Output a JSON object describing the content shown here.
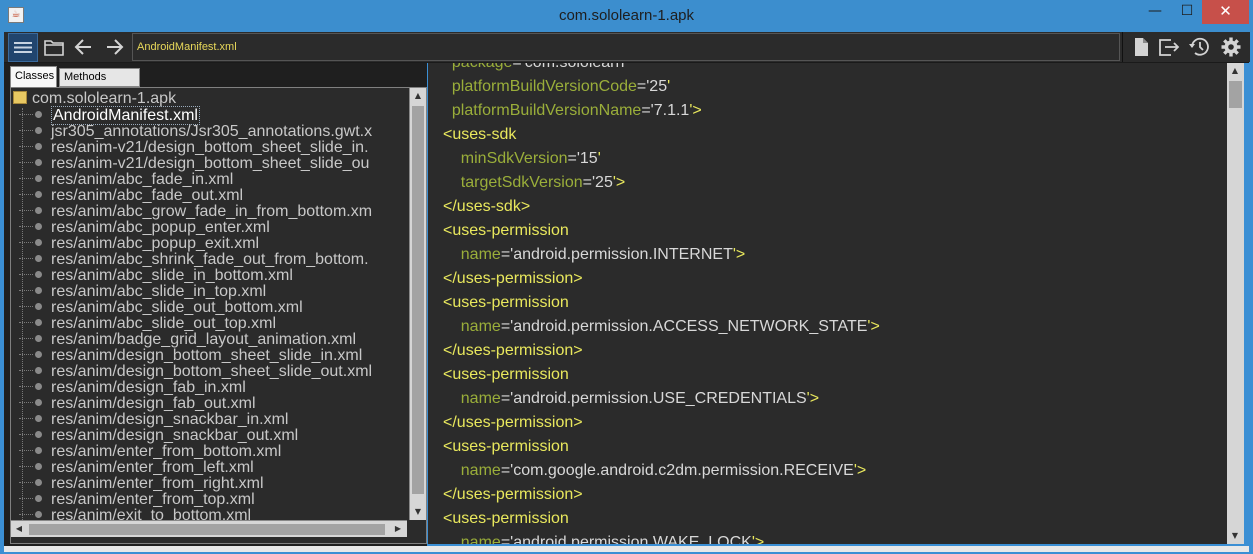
{
  "window": {
    "title": "com.sololearn-1.apk",
    "minimize": "—",
    "maximize": "☐",
    "close": "✕"
  },
  "toolbar": {
    "path": "AndroidManifest.xml",
    "icons": [
      "menu-icon",
      "folder-open-icon",
      "back-arrow-icon",
      "forward-arrow-icon",
      "file-icon",
      "export-icon",
      "history-icon",
      "gear-icon"
    ]
  },
  "tabs": {
    "classes": "Classes",
    "methods_count": "Methods count"
  },
  "tree": {
    "root": "com.sololearn-1.apk",
    "items": [
      "AndroidManifest.xml",
      "jsr305_annotations/Jsr305_annotations.gwt.x",
      "res/anim-v21/design_bottom_sheet_slide_in.",
      "res/anim-v21/design_bottom_sheet_slide_ou",
      "res/anim/abc_fade_in.xml",
      "res/anim/abc_fade_out.xml",
      "res/anim/abc_grow_fade_in_from_bottom.xm",
      "res/anim/abc_popup_enter.xml",
      "res/anim/abc_popup_exit.xml",
      "res/anim/abc_shrink_fade_out_from_bottom.",
      "res/anim/abc_slide_in_bottom.xml",
      "res/anim/abc_slide_in_top.xml",
      "res/anim/abc_slide_out_bottom.xml",
      "res/anim/abc_slide_out_top.xml",
      "res/anim/badge_grid_layout_animation.xml",
      "res/anim/design_bottom_sheet_slide_in.xml",
      "res/anim/design_bottom_sheet_slide_out.xml",
      "res/anim/design_fab_in.xml",
      "res/anim/design_fab_out.xml",
      "res/anim/design_snackbar_in.xml",
      "res/anim/design_snackbar_out.xml",
      "res/anim/enter_from_bottom.xml",
      "res/anim/enter_from_left.xml",
      "res/anim/enter_from_right.xml",
      "res/anim/enter_from_top.xml",
      "res/anim/exit_to_bottom.xml"
    ]
  },
  "code": {
    "lines": [
      {
        "indent": "  ",
        "attr": "package",
        "eq": "='",
        "val": "com.sololearn",
        "close": "'"
      },
      {
        "indent": "  ",
        "attr": "platformBuildVersionCode",
        "eq": "='",
        "val": "25",
        "close": "'"
      },
      {
        "indent": "  ",
        "attr": "platformBuildVersionName",
        "eq": "='",
        "val": "7.1.1",
        "close": "'>"
      },
      {
        "tag": "<uses-sdk"
      },
      {
        "indent": "    ",
        "attr": "minSdkVersion",
        "eq": "='",
        "val": "15",
        "close": "'"
      },
      {
        "indent": "    ",
        "attr": "targetSdkVersion",
        "eq": "='",
        "val": "25",
        "close": "'>"
      },
      {
        "tag": "</uses-sdk>"
      },
      {
        "tag": "<uses-permission"
      },
      {
        "indent": "    ",
        "attr": "name",
        "eq": "='",
        "val": "android.permission.INTERNET",
        "close": "'>"
      },
      {
        "tag": "</uses-permission>"
      },
      {
        "tag": "<uses-permission"
      },
      {
        "indent": "    ",
        "attr": "name",
        "eq": "='",
        "val": "android.permission.ACCESS_NETWORK_STATE",
        "close": "'>"
      },
      {
        "tag": "</uses-permission>"
      },
      {
        "tag": "<uses-permission"
      },
      {
        "indent": "    ",
        "attr": "name",
        "eq": "='",
        "val": "android.permission.USE_CREDENTIALS",
        "close": "'>"
      },
      {
        "tag": "</uses-permission>"
      },
      {
        "tag": "<uses-permission"
      },
      {
        "indent": "    ",
        "attr": "name",
        "eq": "='",
        "val": "com.google.android.c2dm.permission.RECEIVE",
        "close": "'>"
      },
      {
        "tag": "</uses-permission>"
      },
      {
        "tag": "<uses-permission"
      },
      {
        "indent": "    ",
        "attr": "name",
        "eq": "='",
        "val": "android.permission.WAKE_LOCK",
        "close": "'>"
      }
    ]
  },
  "colors": {
    "tag": "#e9e85d",
    "attribute": "#9aae3a",
    "value": "#d8d8d8",
    "editor_bg": "#2b2b2b",
    "title_bar": "#3c8ece",
    "close_button": "#c7504a"
  }
}
